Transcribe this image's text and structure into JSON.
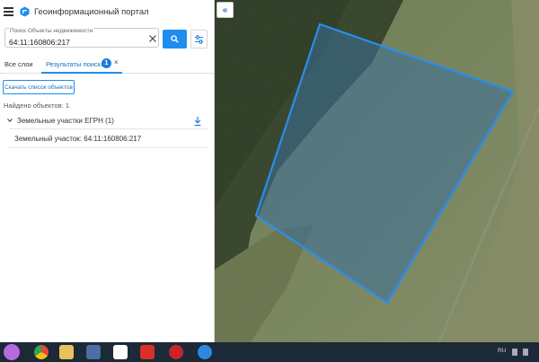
{
  "header": {
    "title": "Геоинформационный портал"
  },
  "search": {
    "label": "Поиск Объекты недвижимости",
    "value": "64:11:160806:217"
  },
  "tabs": {
    "layers": "Все слои",
    "results": "Результаты поиска",
    "results_count": "1",
    "close": "×"
  },
  "actions": {
    "download_list": "Скачать список объектов"
  },
  "results": {
    "found_label": "Найдено объектов: 1",
    "group_label": "Земельные участки ЕГРН (1)",
    "items": [
      {
        "label": "Земельный участок: 64:11:160806:217"
      }
    ]
  },
  "map": {
    "collapse_label": "«",
    "parcel_stroke": "#2a8df0",
    "parcel_fill": "#3a6f9a"
  },
  "taskbar": {
    "lang": "RU"
  },
  "colors": {
    "accent": "#1d8ef0"
  }
}
